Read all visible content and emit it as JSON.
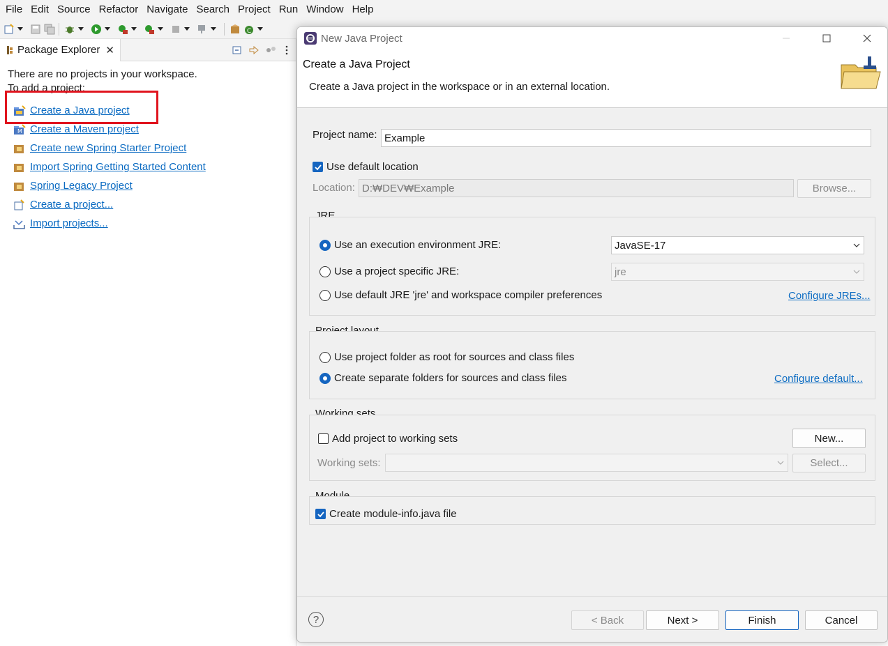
{
  "menubar": {
    "items": [
      "File",
      "Edit",
      "Source",
      "Refactor",
      "Navigate",
      "Search",
      "Project",
      "Run",
      "Window",
      "Help"
    ]
  },
  "explorer": {
    "tab_label": "Package Explorer",
    "message_line1": "There are no projects in your workspace.",
    "message_line2": "To add a project:",
    "links": [
      {
        "label": "Create a Java project",
        "icon": "java-project-icon"
      },
      {
        "label": "Create a Maven project",
        "icon": "maven-project-icon"
      },
      {
        "label": "Create new Spring Starter Project",
        "icon": "spring-starter-icon"
      },
      {
        "label": "Import Spring Getting Started Content",
        "icon": "spring-import-icon"
      },
      {
        "label": "Spring Legacy Project",
        "icon": "spring-legacy-icon"
      },
      {
        "label": "Create a project...",
        "icon": "new-project-icon"
      },
      {
        "label": "Import projects...",
        "icon": "import-projects-icon"
      }
    ]
  },
  "dialog": {
    "window_title": "New Java Project",
    "banner_title": "Create a Java Project",
    "banner_desc": "Create a Java project in the workspace or in an external location.",
    "project_name_label": "Project name:",
    "project_name_value": "Example",
    "use_default_location_label": "Use default location",
    "use_default_location_checked": true,
    "location_label": "Location:",
    "location_value": "D:₩DEV₩Example",
    "browse_label": "Browse...",
    "jre": {
      "group_label": "JRE",
      "option_env_label": "Use an execution environment JRE:",
      "option_env_value": "JavaSE-17",
      "option_specific_label": "Use a project specific JRE:",
      "option_specific_value": "jre",
      "option_default_label": "Use default JRE 'jre' and workspace compiler preferences",
      "configure_link": "Configure JREs..."
    },
    "layout": {
      "group_label": "Project layout",
      "option_root_label": "Use project folder as root for sources and class files",
      "option_separate_label": "Create separate folders for sources and class files",
      "configure_link": "Configure default..."
    },
    "working_sets": {
      "group_label": "Working sets",
      "add_label": "Add project to working sets",
      "new_label": "New...",
      "sets_label": "Working sets:",
      "select_label": "Select..."
    },
    "module": {
      "group_label": "Module",
      "create_module_label": "Create module-info.java file",
      "create_module_checked": true
    },
    "buttons": {
      "help": "?",
      "back": "< Back",
      "next": "Next >",
      "finish": "Finish",
      "cancel": "Cancel"
    }
  },
  "colors": {
    "accent": "#1565c0",
    "link": "#0b6bc2",
    "highlight": "#e0141e"
  }
}
